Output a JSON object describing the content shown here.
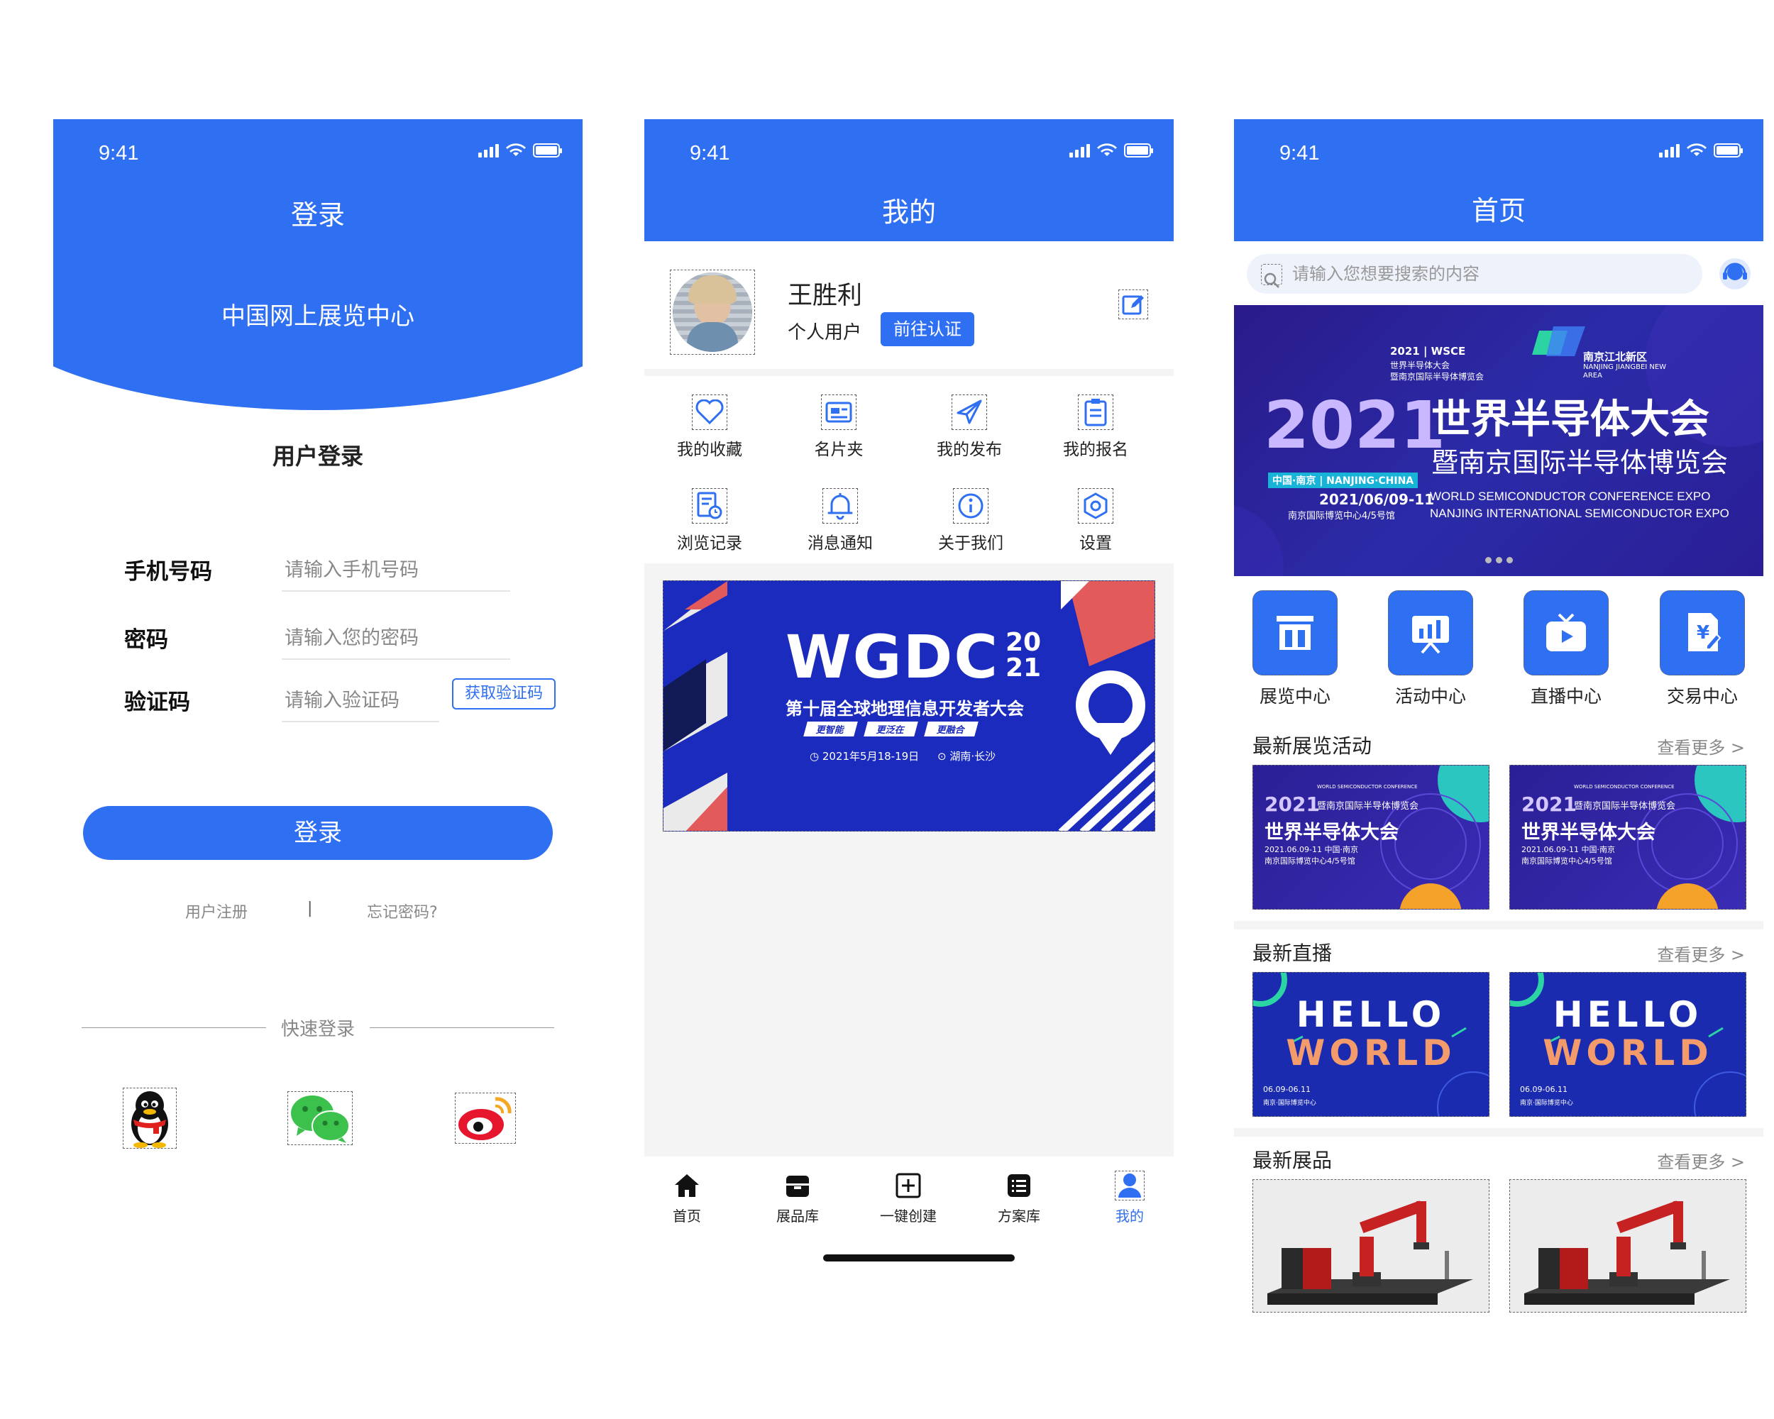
{
  "status": {
    "time": "9:41"
  },
  "login": {
    "title": "登录",
    "subtitle": "中国网上展览中心",
    "section_title": "用户登录",
    "phone_label": "手机号码",
    "phone_placeholder": "请输入手机号码",
    "password_label": "密码",
    "password_placeholder": "请输入您的密码",
    "code_label": "验证码",
    "code_placeholder": "请输入验证码",
    "get_code": "获取验证码",
    "login_button": "登录",
    "register": "用户注册",
    "separator": "|",
    "forgot": "忘记密码?",
    "quick_login": "快速登录",
    "social": [
      "qq-icon",
      "wechat-icon",
      "weibo-icon"
    ]
  },
  "mine": {
    "title": "我的",
    "user_name": "王胜利",
    "user_type": "个人用户",
    "cert_button": "前往认证",
    "grid": [
      {
        "label": "我的收藏",
        "icon": "heart-icon"
      },
      {
        "label": "名片夹",
        "icon": "card-holder-icon"
      },
      {
        "label": "我的发布",
        "icon": "send-icon"
      },
      {
        "label": "我的报名",
        "icon": "clipboard-icon"
      },
      {
        "label": "浏览记录",
        "icon": "history-icon"
      },
      {
        "label": "消息通知",
        "icon": "bell-icon"
      },
      {
        "label": "关于我们",
        "icon": "info-icon"
      },
      {
        "label": "设置",
        "icon": "settings-icon"
      }
    ],
    "banner": {
      "title": "WGDC",
      "year_top": "20",
      "year_bottom": "21",
      "subtitle": "第十届全球地理信息开发者大会",
      "tags": [
        "更智能",
        "更泛在",
        "更融合"
      ],
      "date": "2021年5月18-19日",
      "place": "湖南·长沙"
    },
    "tabs": [
      {
        "label": "首页",
        "icon": "home-icon"
      },
      {
        "label": "展品库",
        "icon": "box-icon"
      },
      {
        "label": "一键创建",
        "icon": "plus-square-icon"
      },
      {
        "label": "方案库",
        "icon": "list-icon"
      },
      {
        "label": "我的",
        "icon": "user-icon"
      }
    ],
    "active_tab_color": "#2F6FF2"
  },
  "home": {
    "title": "首页",
    "search_placeholder": "请输入您想要搜索的内容",
    "banner": {
      "org1": "2021 | WSCE",
      "org1_sub": "世界半导体大会",
      "org1_sub2": "暨南京国际半导体博览会",
      "org2": "南京江北新区",
      "org2_en": "NANJING JIANGBEI NEW AREA",
      "year": "2021",
      "title1": "世界半导体大会",
      "title2": "暨南京国际半导体博览会",
      "city": "中国·南京 | NANJING·CHINA",
      "date": "2021/06/09-11",
      "venue": "南京国际博览中心4/5号馆",
      "en1": "WORLD SEMICONDUCTOR CONFERENCE EXPO",
      "en2": "NANJING INTERNATIONAL SEMICONDUCTOR EXPO"
    },
    "categories": [
      {
        "label": "展览中心",
        "icon": "exhibition-icon"
      },
      {
        "label": "活动中心",
        "icon": "chart-board-icon"
      },
      {
        "label": "直播中心",
        "icon": "tv-play-icon"
      },
      {
        "label": "交易中心",
        "icon": "yuan-doc-icon"
      }
    ],
    "sections": [
      {
        "title": "最新展览活动",
        "more": "查看更多 >"
      },
      {
        "title": "最新直播",
        "more": "查看更多 >"
      },
      {
        "title": "最新展品",
        "more": "查看更多 >"
      }
    ],
    "expo_card": {
      "small": "WORLD SEMICONDUCTOR CONFERENCE",
      "year": "2021",
      "sub": "暨南京国际半导体博览会",
      "title": "世界半导体大会",
      "date": "2021.06.09-11 中国·南京",
      "venue": "南京国际博览中心4/5号馆"
    },
    "live_card": {
      "line1": "HELLO",
      "line2": "WORLD",
      "date": "06.09-06.11",
      "venue": "南京·国际博览中心"
    },
    "accent": "#2F6FF2"
  }
}
